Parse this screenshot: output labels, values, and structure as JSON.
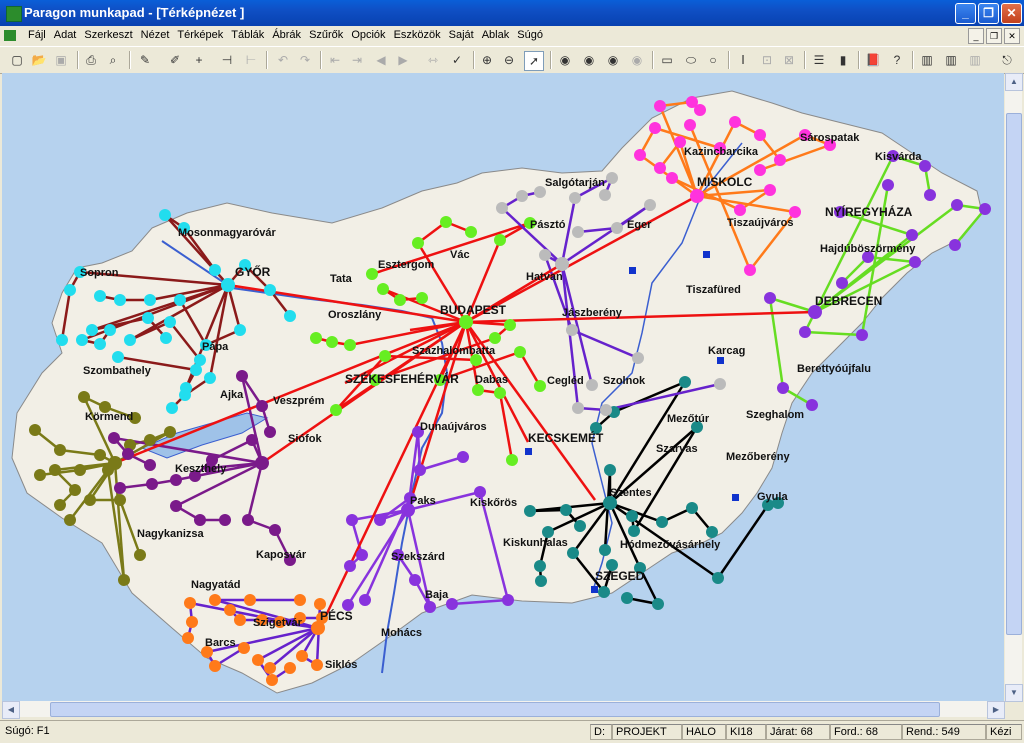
{
  "window": {
    "title": "Paragon munkapad - [Térképnézet ]",
    "minimize": "_",
    "restore": "❐",
    "close": "✕"
  },
  "menu": {
    "items": [
      "Fájl",
      "Adat",
      "Szerkeszt",
      "Nézet",
      "Térképek",
      "Táblák",
      "Ábrák",
      "Szűrők",
      "Opciók",
      "Eszközök",
      "Saját",
      "Ablak",
      "Súgó"
    ],
    "mdi_min": "_",
    "mdi_restore": "❐",
    "mdi_close": "✕"
  },
  "toolbar": {
    "icons": [
      "new-icon",
      "open-icon",
      "save-icon",
      "print-icon",
      "print-preview-icon",
      "edit-pen-icon",
      "draw-pen-icon",
      "node-add-icon",
      "link-icon",
      "link-split-icon",
      "undo-icon",
      "redo-icon",
      "align-left-icon",
      "align-right-icon",
      "arrow-left-icon",
      "arrow-right-icon",
      "route-icon",
      "route-check-icon",
      "zoom-in-icon",
      "zoom-out-icon",
      "pointer-icon",
      "globe-icon",
      "globe-2-icon",
      "globe-3-icon",
      "globe-4-icon",
      "rect-select-icon",
      "ellipse-select-icon",
      "circle-select-icon",
      "text-cursor-icon",
      "node-select-icon",
      "delete-select-icon",
      "table-icon",
      "bar-chart-icon",
      "book-icon",
      "help-cursor-icon",
      "panel-1-icon",
      "panel-2-icon",
      "panel-3-icon",
      "exit-icon"
    ]
  },
  "map": {
    "background": "#b6d2ee",
    "land": "#f2efe6",
    "cities": [
      {
        "name": "Miskolc",
        "label": "MISKOLC",
        "big": true
      },
      {
        "name": "Nyiregyhaza",
        "label": "NYÍREGYHÁZA",
        "big": true
      },
      {
        "name": "Debrecen",
        "label": "DEBRECEN",
        "big": true
      },
      {
        "name": "Budapest",
        "label": "BUDAPEST",
        "big": true
      },
      {
        "name": "Gyor",
        "label": "GYŐR",
        "big": true
      },
      {
        "name": "Szekesfehervar",
        "label": "SZÉKESFEHÉRVÁR",
        "big": true
      },
      {
        "name": "Kecskemet",
        "label": "KECSKEMÉT",
        "big": true
      },
      {
        "name": "Szeged",
        "label": "SZEGED",
        "big": true
      },
      {
        "name": "Pecs",
        "label": "PÉCS",
        "big": true
      },
      {
        "name": "Salgotarjan",
        "label": "Salgótarján"
      },
      {
        "name": "Sarospatak",
        "label": "Sárospatak"
      },
      {
        "name": "Kisvarda",
        "label": "Kisvárda"
      },
      {
        "name": "Kazincbarcika",
        "label": "Kazincbarcika"
      },
      {
        "name": "Tiszaujvaros",
        "label": "Tiszaújváros"
      },
      {
        "name": "Eger",
        "label": "Eger"
      },
      {
        "name": "Paszto",
        "label": "Pásztó"
      },
      {
        "name": "Hajduboszormeny",
        "label": "Hajdúböszörmény"
      },
      {
        "name": "Tiszafured",
        "label": "Tiszafüred"
      },
      {
        "name": "Hatvan",
        "label": "Hatvan"
      },
      {
        "name": "Vac",
        "label": "Vác"
      },
      {
        "name": "Esztergom",
        "label": "Esztergom"
      },
      {
        "name": "Mosonmagyarovar",
        "label": "Mosonmagyaróvár"
      },
      {
        "name": "Sopron",
        "label": "Sopron"
      },
      {
        "name": "Tata",
        "label": "Tata"
      },
      {
        "name": "Oroszlany",
        "label": "Oroszlány"
      },
      {
        "name": "Szazhalombatta",
        "label": "Százhalombatta"
      },
      {
        "name": "Jaszbereny",
        "label": "Jászberény"
      },
      {
        "name": "Karcag",
        "label": "Karcag"
      },
      {
        "name": "Berettyoujfalu",
        "label": "Berettyóújfalu"
      },
      {
        "name": "Szombathely",
        "label": "Szombathely"
      },
      {
        "name": "Papa",
        "label": "Pápa"
      },
      {
        "name": "Ajka",
        "label": "Ajka"
      },
      {
        "name": "Veszprem",
        "label": "Veszprém"
      },
      {
        "name": "Dabas",
        "label": "Dabas"
      },
      {
        "name": "Cegled",
        "label": "Cegléd"
      },
      {
        "name": "Szolnok",
        "label": "Szolnok"
      },
      {
        "name": "Mezotur",
        "label": "Mezőtúr"
      },
      {
        "name": "Szeghalom",
        "label": "Szeghalom"
      },
      {
        "name": "Kormend",
        "label": "Körmend"
      },
      {
        "name": "Siofok",
        "label": "Siófok"
      },
      {
        "name": "Dunaujvaros",
        "label": "Dunaújváros"
      },
      {
        "name": "Szarvas",
        "label": "Szarvas"
      },
      {
        "name": "Mezobereny",
        "label": "Mezőberény"
      },
      {
        "name": "Keszthely",
        "label": "Keszthely"
      },
      {
        "name": "Paks",
        "label": "Paks"
      },
      {
        "name": "Kiskoros",
        "label": "Kiskőrös"
      },
      {
        "name": "Szentes",
        "label": "Szentes"
      },
      {
        "name": "Gyula",
        "label": "Gyula"
      },
      {
        "name": "Nagykanizsa",
        "label": "Nagykanizsa"
      },
      {
        "name": "Kaposvar",
        "label": "Kaposvár"
      },
      {
        "name": "Szekszard",
        "label": "Szekszárd"
      },
      {
        "name": "Kiskunhalas",
        "label": "Kiskunhalas"
      },
      {
        "name": "Hodmezovasarhely",
        "label": "Hódmezővásárhely"
      },
      {
        "name": "Nagyatad",
        "label": "Nagyatád"
      },
      {
        "name": "Baja",
        "label": "Baja"
      },
      {
        "name": "Szigetvar",
        "label": "Szigetvár"
      },
      {
        "name": "Barcs",
        "label": "Barcs"
      },
      {
        "name": "Mohacs",
        "label": "Mohács"
      },
      {
        "name": "Siklos",
        "label": "Siklós"
      }
    ],
    "clusters": [
      {
        "name": "miskolc",
        "color": "#ff33dd",
        "line": "#ff7a1a"
      },
      {
        "name": "debrecen",
        "color": "#8833dd",
        "line": "#66dd22"
      },
      {
        "name": "budapest",
        "color": "#66ee22",
        "line": "#ee1111"
      },
      {
        "name": "gyor",
        "color": "#22ddee",
        "line": "#8b1a1a"
      },
      {
        "name": "szombathely",
        "color": "#7a7a18",
        "line": "#7a7a18"
      },
      {
        "name": "keszthely",
        "color": "#7a1a8a",
        "line": "#7a1a8a"
      },
      {
        "name": "paks",
        "color": "#8833dd",
        "line": "#8833dd"
      },
      {
        "name": "szeged",
        "color": "#1a8a88",
        "line": "#000000"
      },
      {
        "name": "pecs",
        "color": "#ff7a1a",
        "line": "#6622cc"
      },
      {
        "name": "hatvan",
        "color": "#bbbbbb",
        "line": "#6622cc"
      }
    ]
  },
  "status": {
    "help": "Súgó: F1",
    "drive": "D:",
    "project": "PROJEKT",
    "network": "HALO",
    "variant": "KI18",
    "jarat": "Járat: 68",
    "ford": "Ford.: 68",
    "rend": "Rend.: 549",
    "mode": "Kézi"
  }
}
